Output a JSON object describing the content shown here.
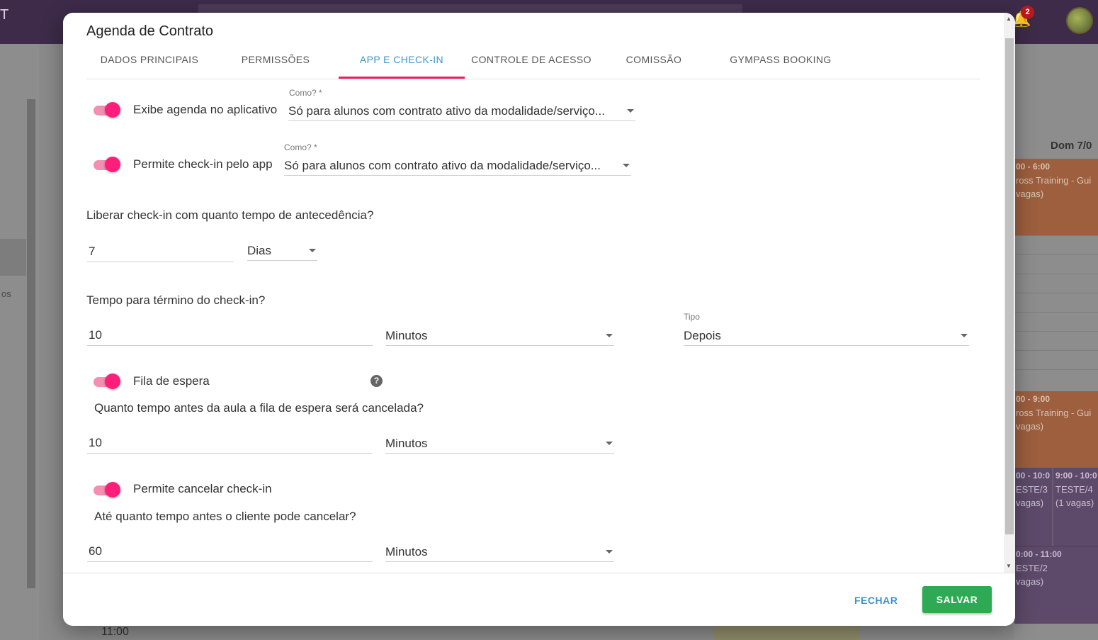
{
  "background": {
    "brand_letter": "T",
    "notification_count": "2",
    "side_text": "os",
    "time_bottom": "11:00",
    "calendar": {
      "day_header": "Dom 7/0",
      "events": [
        {
          "time": "00 - 6:00",
          "line1": "ross Training - Gui",
          "line2": "vagas)"
        },
        {
          "time": "00 - 9:00",
          "line1": "ross Training - Gui",
          "line2": "vagas)"
        },
        {
          "time": "00 - 10:0",
          "line1": "ESTE/3",
          "line2": "vagas)"
        },
        {
          "time": "9:00 - 10:0",
          "line1": "TESTE/4",
          "line2": "(1 vagas)"
        },
        {
          "time": "0:00 - 11:00",
          "line1": "ESTE/2",
          "line2": "vagas)"
        }
      ]
    }
  },
  "modal": {
    "title": "Agenda de Contrato",
    "tabs": [
      {
        "label": "DADOS PRINCIPAIS",
        "active": false
      },
      {
        "label": "PERMISSÕES",
        "active": false
      },
      {
        "label": "APP E CHECK-IN",
        "active": true
      },
      {
        "label": "CONTROLE DE ACESSO",
        "active": false
      },
      {
        "label": "COMISSÃO",
        "active": false
      },
      {
        "label": "GYMPASS BOOKING",
        "active": false
      }
    ],
    "show_agenda": {
      "label": "Exibe agenda no aplicativo",
      "enabled": true,
      "como_label": "Como? *",
      "como_value": "Só para alunos com contrato ativo da modalidade/serviço..."
    },
    "allow_checkin": {
      "label": "Permite check-in pelo app",
      "enabled": true,
      "como_label": "Como? *",
      "como_value": "Só para alunos com contrato ativo da modalidade/serviço..."
    },
    "advance": {
      "question": "Liberar check-in com quanto tempo de antecedência?",
      "value": "7",
      "unit": "Dias"
    },
    "end_time": {
      "question": "Tempo para término do check-in?",
      "value": "10",
      "unit": "Minutos",
      "tipo_label": "Tipo",
      "tipo_value": "Depois"
    },
    "waitlist": {
      "label": "Fila de espera",
      "enabled": true,
      "help": "?",
      "question": "Quanto tempo antes da aula a fila de espera será cancelada?",
      "value": "10",
      "unit": "Minutos"
    },
    "cancel_checkin": {
      "label": "Permite cancelar check-in",
      "enabled": true,
      "question": "Até quanto tempo antes o cliente pode cancelar?",
      "value": "60",
      "unit": "Minutos"
    },
    "footer": {
      "close_label": "FECHAR",
      "save_label": "SALVAR"
    }
  },
  "colors": {
    "accent_blue": "#3e95cd",
    "tab_indicator": "#e91e63",
    "toggle_on": "#ff1f7a",
    "save_green": "#2eaa55"
  }
}
